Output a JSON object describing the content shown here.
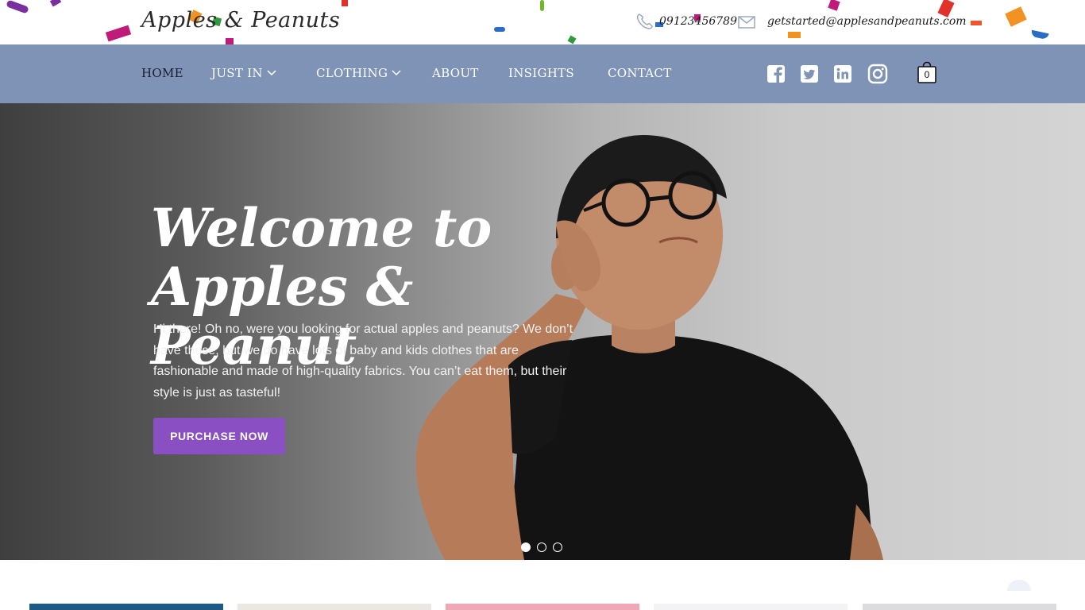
{
  "header": {
    "logo_text": "Apples & Peanuts",
    "phone": "09123456789",
    "email": "getstarted@applesandpeanuts.com"
  },
  "nav": {
    "items": [
      {
        "label": "Home"
      },
      {
        "label": "Just In"
      },
      {
        "label": "Clothing"
      },
      {
        "label": "About"
      },
      {
        "label": "Insights"
      },
      {
        "label": "Contact"
      }
    ],
    "social": [
      "facebook-icon",
      "twitter-icon",
      "linkedin-icon",
      "instagram-icon"
    ],
    "cart_count": "0"
  },
  "hero": {
    "title_line1": "Welcome to",
    "title_line2": "Apples & Peanut",
    "text": "Hi there! Oh no, were you looking for actual apples and peanuts? We don’t have those, but we do have lots of baby and kids clothes that are fashionable and made of high-quality fabrics. You can’t eat them, but their style is just as tasteful!",
    "button_label": "PURCHASE NOW",
    "slides_total": 3,
    "slide_active": 1
  },
  "colors": {
    "nav_bg": "#7f93b7",
    "button": "#8a4fc2",
    "active_nav": "#1a1a2e"
  }
}
